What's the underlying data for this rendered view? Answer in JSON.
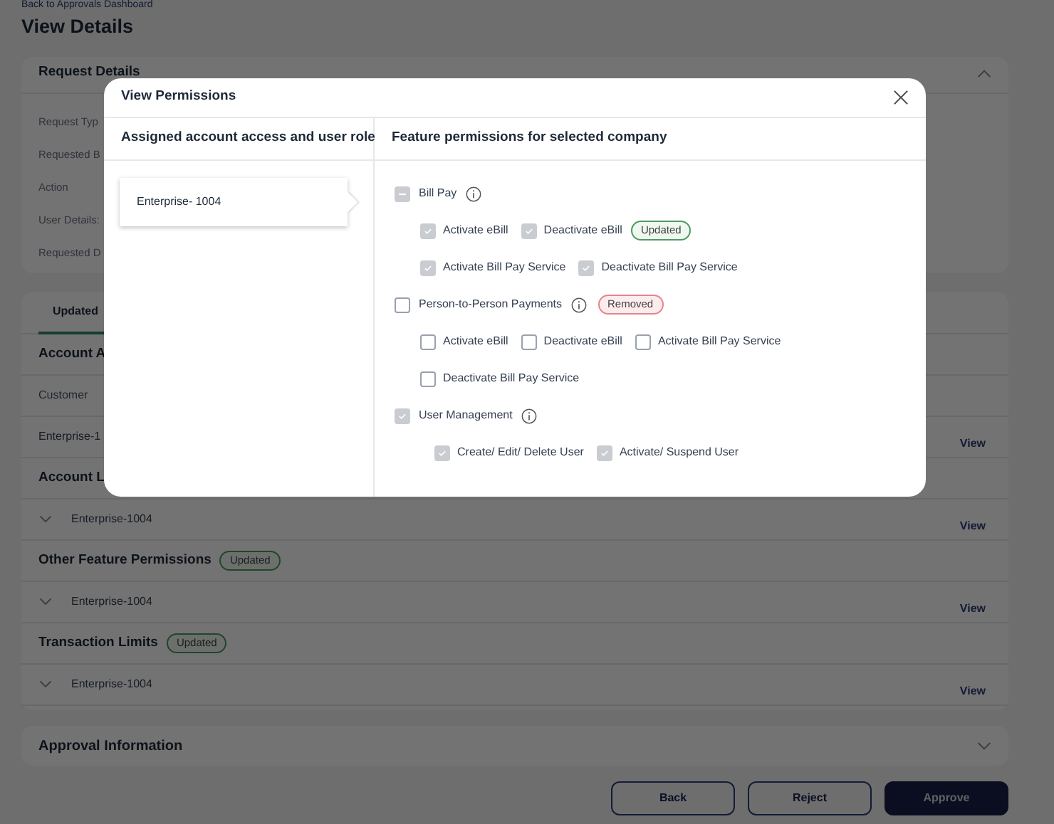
{
  "breadcrumb": "Back to Approvals Dashboard",
  "page_title": "View Details",
  "request_details": {
    "title": "Request Details",
    "expanded": true,
    "fields": [
      "Request Typ",
      "Requested B",
      "Action",
      "User Details:",
      "Requested D"
    ]
  },
  "changes": {
    "tabs": [
      {
        "label": "Updated",
        "selected": true
      }
    ],
    "sections": [
      {
        "title": "Account A",
        "rows": [
          {
            "kind": "label",
            "text": "Customer"
          },
          {
            "kind": "plain",
            "text": "Enterprise-1",
            "link": "View"
          }
        ]
      },
      {
        "title": "Account L",
        "rows": [
          {
            "kind": "expandable",
            "text": "Enterprise-1004",
            "link": "View"
          }
        ]
      },
      {
        "title": "Other Feature Permissions",
        "badge": "Updated",
        "rows": [
          {
            "kind": "expandable",
            "text": "Enterprise-1004",
            "link": "View"
          }
        ]
      },
      {
        "title": "Transaction Limits",
        "badge": "Updated",
        "rows": [
          {
            "kind": "expandable",
            "text": "Enterprise-1004",
            "link": "View"
          }
        ]
      }
    ]
  },
  "approval_information": {
    "title": "Approval Information",
    "expanded": false
  },
  "actions": [
    {
      "label": "Back",
      "kind": "secondary"
    },
    {
      "label": "Reject",
      "kind": "secondary"
    },
    {
      "label": "Approve",
      "kind": "primary"
    }
  ],
  "modal": {
    "title": "View Permissions",
    "left_heading": "Assigned account access and user role",
    "right_heading": "Feature permissions for selected company",
    "companies": [
      {
        "name": "Enterprise- 1004",
        "selected": true
      }
    ],
    "features": [
      {
        "label": "Bill Pay",
        "checked": false,
        "indeterminate": true,
        "info": true,
        "options": [
          {
            "label": "Activate eBill",
            "checked": true
          },
          {
            "label": "Deactivate eBill",
            "checked": true,
            "badge": {
              "text": "Updated",
              "kind": "updated"
            }
          },
          {
            "label": "Activate Bill Pay Service",
            "checked": true
          },
          {
            "label": "Deactivate Bill Pay Service",
            "checked": true
          }
        ]
      },
      {
        "label": "Person-to-Person Payments",
        "checked": false,
        "indeterminate": false,
        "info": true,
        "badge": {
          "text": "Removed",
          "kind": "removed"
        },
        "options": [
          {
            "label": "Activate eBill",
            "checked": false
          },
          {
            "label": "Deactivate eBill",
            "checked": false
          },
          {
            "label": "Activate Bill Pay Service",
            "checked": false
          },
          {
            "label": "Deactivate Bill Pay Service",
            "checked": false
          }
        ]
      },
      {
        "label": "User Management",
        "checked": true,
        "indeterminate": false,
        "info": true,
        "options": [
          {
            "label": "Create/ Edit/ Delete User",
            "checked": true
          },
          {
            "label": "Activate/ Suspend User",
            "checked": true
          }
        ]
      }
    ]
  }
}
